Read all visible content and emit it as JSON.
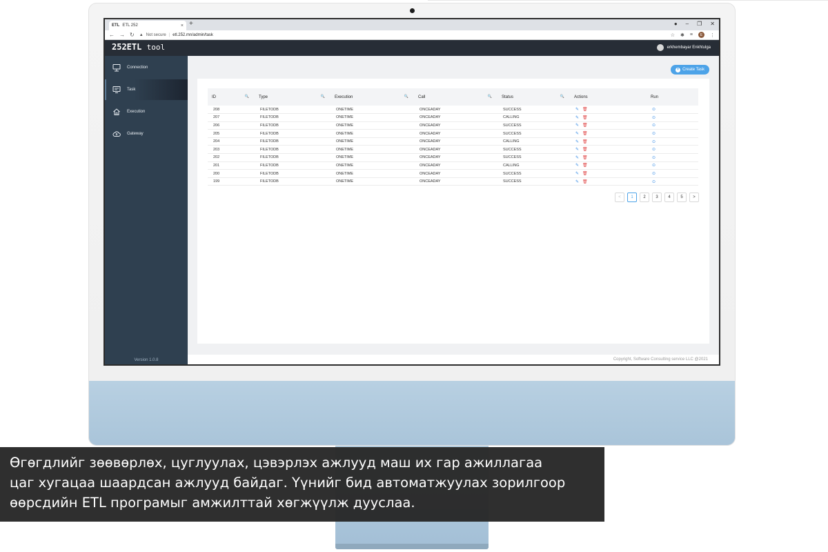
{
  "browser": {
    "tab_title": "ETL 252",
    "favicon": "ETL",
    "tab_close": "×",
    "new_tab": "+",
    "security_label": "Not secure",
    "url": "etl.252.mn/admin/task",
    "profile_initial": "E"
  },
  "app": {
    "logo_main": "252ETL",
    "logo_sub": "tool",
    "user_name": "erkhembayar Enkhtulga",
    "version": "Version 1.0.8",
    "footer": "Copyright, Software Consulting service LLC @2021"
  },
  "sidebar": {
    "items": [
      {
        "label": "Connection",
        "icon": "connection-icon"
      },
      {
        "label": "Task",
        "icon": "task-icon",
        "active": true
      },
      {
        "label": "Execution",
        "icon": "home-icon"
      },
      {
        "label": "Gateway",
        "icon": "cloud-upload-icon"
      }
    ]
  },
  "toolbar": {
    "create_task_label": "Create Task"
  },
  "table": {
    "columns": [
      "ID",
      "Type",
      "Execution",
      "Call",
      "Status",
      "Actions",
      "Run"
    ],
    "rows": [
      {
        "id": "208",
        "type": "FILETODB",
        "execution": "ONETIME",
        "call": "ONCEADAY",
        "status": "SUCCESS"
      },
      {
        "id": "207",
        "type": "FILETODB",
        "execution": "ONETIME",
        "call": "ONCEADAY",
        "status": "CALLING"
      },
      {
        "id": "206",
        "type": "FILETODB",
        "execution": "ONETIME",
        "call": "ONCEADAY",
        "status": "SUCCESS"
      },
      {
        "id": "205",
        "type": "FILETODB",
        "execution": "ONETIME",
        "call": "ONCEADAY",
        "status": "SUCCESS"
      },
      {
        "id": "204",
        "type": "FILETODB",
        "execution": "ONETIME",
        "call": "ONCEADAY",
        "status": "CALLING"
      },
      {
        "id": "203",
        "type": "FILETODB",
        "execution": "ONETIME",
        "call": "ONCEADAY",
        "status": "SUCCESS"
      },
      {
        "id": "202",
        "type": "FILETODB",
        "execution": "ONETIME",
        "call": "ONCEADAY",
        "status": "SUCCESS"
      },
      {
        "id": "201",
        "type": "FILETODB",
        "execution": "ONETIME",
        "call": "ONCEADAY",
        "status": "CALLING"
      },
      {
        "id": "200",
        "type": "FILETODB",
        "execution": "ONETIME",
        "call": "ONCEADAY",
        "status": "SUCCESS"
      },
      {
        "id": "199",
        "type": "FILETODB",
        "execution": "ONETIME",
        "call": "ONCEADAY",
        "status": "SUCCESS"
      }
    ]
  },
  "pagination": {
    "prev": "<",
    "pages": [
      "1",
      "2",
      "3",
      "4",
      "5"
    ],
    "current": "1",
    "next": ">"
  },
  "caption": {
    "lines": [
      "Өгөгдлийг зөөвөрлөх, цуглуулах, цэвэрлэх ажлууд маш их гар ажиллагаа",
      "цаг хугацаа шаардсан ажлууд байдаг. Үүнийг бид автоматжуулах зорилгоор",
      "өөрсдийн ETL програмыг амжилттай хөгжүүлж дууслаа."
    ]
  },
  "colors": {
    "header_bg": "#272d36",
    "sidebar_bg": "#2f4050",
    "accent": "#4da3e8",
    "delete_red": "#e04848",
    "imac_chin": "#b8d0e2"
  }
}
